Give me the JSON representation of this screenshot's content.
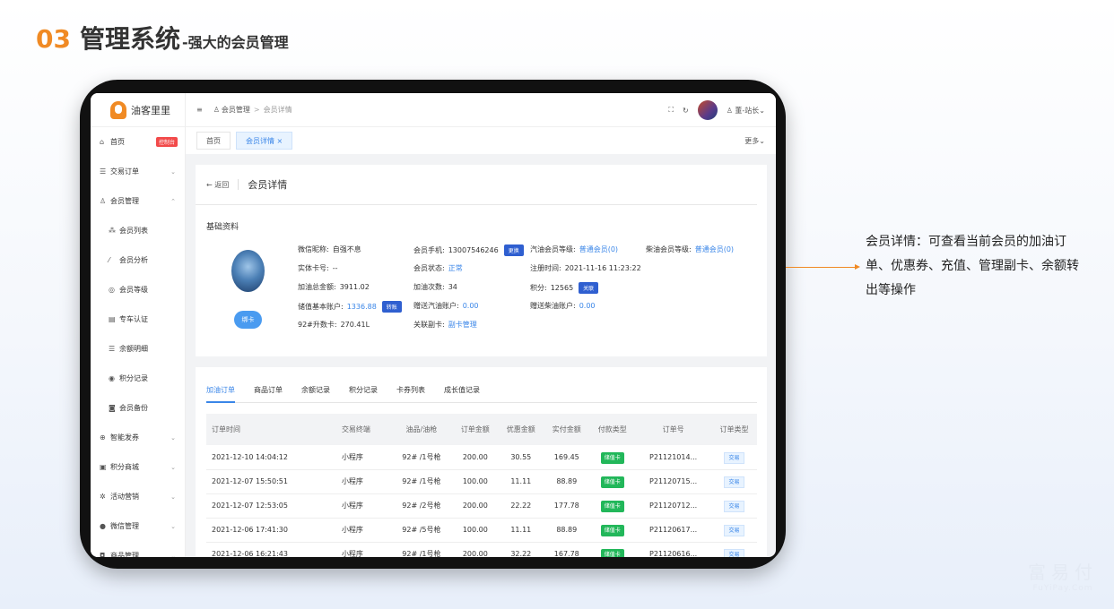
{
  "slide": {
    "num": "03",
    "title": "管理系统",
    "subtitle": "-强大的会员管理"
  },
  "app": {
    "logo_text": "油客里里"
  },
  "sidebar": {
    "items": [
      {
        "icon": "⌂",
        "label": "首页",
        "badge": "控制台"
      },
      {
        "icon": "☰",
        "label": "交易订单",
        "chev": "⌄"
      },
      {
        "icon": "♙",
        "label": "会员管理",
        "chev": "⌃"
      },
      {
        "icon": "⁂",
        "label": "会员列表",
        "sub": true
      },
      {
        "icon": "⁄",
        "label": "会员分析",
        "sub": true
      },
      {
        "icon": "◎",
        "label": "会员等级",
        "sub": true
      },
      {
        "icon": "▤",
        "label": "专车认证",
        "sub": true
      },
      {
        "icon": "☰",
        "label": "余额明细",
        "sub": true
      },
      {
        "icon": "◉",
        "label": "积分记录",
        "sub": true
      },
      {
        "icon": "◙",
        "label": "会员备份",
        "sub": true
      },
      {
        "icon": "⊕",
        "label": "智能发券",
        "chev": "⌄"
      },
      {
        "icon": "▣",
        "label": "积分商城",
        "chev": "⌄"
      },
      {
        "icon": "✲",
        "label": "活动营销",
        "chev": "⌄"
      },
      {
        "icon": "●",
        "label": "微信管理",
        "chev": "⌄"
      },
      {
        "icon": "◘",
        "label": "商品管理",
        "chev": "⌄"
      }
    ]
  },
  "topbar": {
    "menu_icon": "≡",
    "crumb_icon": "♙",
    "crumb_parent": "会员管理",
    "crumb_sep": ">",
    "crumb_current": "会员详情",
    "fullscreen_icon": "⛶",
    "refresh_icon": "↻",
    "user_icon": "♙",
    "user_label": "董-站长⌄"
  },
  "tabs": {
    "home": "首页",
    "detail": "会员详情 ×",
    "more": "更多⌄"
  },
  "detail": {
    "back": "← 返回",
    "title": "会员详情",
    "section": "基础资料",
    "bind_card": "绑卡",
    "fields": {
      "nickname_l": "微信昵称:",
      "nickname_v": "自强不息",
      "card_l": "实体卡号:",
      "card_v": "--",
      "total_l": "加油总金额:",
      "total_v": "3911.02",
      "basic_l": "储值基本账户:",
      "basic_v": "1336.88",
      "basic_btn": "转账",
      "l92_l": "92#升数卡:",
      "l92_v": "270.41L",
      "phone_l": "会员手机:",
      "phone_v": "13007546246",
      "phone_btn": "更换",
      "status_l": "会员状态:",
      "status_v": "正常",
      "times_l": "加油次数:",
      "times_v": "34",
      "gift_gas_l": "赠送汽油账户:",
      "gift_gas_v": "0.00",
      "sub_l": "关联副卡:",
      "sub_v": "副卡管理",
      "gas_level_l": "汽油会员等级:",
      "gas_level_v": "普通会员(0)",
      "reg_l": "注册时间:",
      "reg_v": "2021-11-16 11:23:22",
      "points_l": "积分:",
      "points_v": "12565",
      "points_btn": "关联",
      "gift_diesel_l": "赠送柴油账户:",
      "gift_diesel_v": "0.00",
      "diesel_level_l": "柴油会员等级:",
      "diesel_level_v": "普通会员(0)"
    }
  },
  "subtabs": [
    "加油订单",
    "商品订单",
    "余额记录",
    "积分记录",
    "卡券列表",
    "成长值记录"
  ],
  "table": {
    "headers": [
      "订单时间",
      "交易终端",
      "油品/油枪",
      "订单金额",
      "优惠金额",
      "实付金额",
      "付款类型",
      "订单号",
      "订单类型"
    ],
    "rows": [
      [
        "2021-12-10 14:04:12",
        "小程序",
        "92# /1号枪",
        "200.00",
        "30.55",
        "169.45",
        "储值卡",
        "P21121014...",
        "交易"
      ],
      [
        "2021-12-07 15:50:51",
        "小程序",
        "92# /1号枪",
        "100.00",
        "11.11",
        "88.89",
        "储值卡",
        "P21120715...",
        "交易"
      ],
      [
        "2021-12-07 12:53:05",
        "小程序",
        "92# /2号枪",
        "200.00",
        "22.22",
        "177.78",
        "储值卡",
        "P21120712...",
        "交易"
      ],
      [
        "2021-12-06 17:41:30",
        "小程序",
        "92# /5号枪",
        "100.00",
        "11.11",
        "88.89",
        "储值卡",
        "P21120617...",
        "交易"
      ],
      [
        "2021-12-06 16:21:43",
        "小程序",
        "92# /1号枪",
        "200.00",
        "32.22",
        "167.78",
        "储值卡",
        "P21120616...",
        "交易"
      ]
    ]
  },
  "callout": {
    "text": "会员详情：可查看当前会员的加油订单、优惠券、充值、管理副卡、余额转出等操作"
  },
  "watermark": {
    "cn": "富易付",
    "en": "FuYiPay.Com"
  },
  "colors": {
    "accent_orange": "#f08a24",
    "link_blue": "#3a86e8",
    "pay_green": "#22b75a"
  }
}
